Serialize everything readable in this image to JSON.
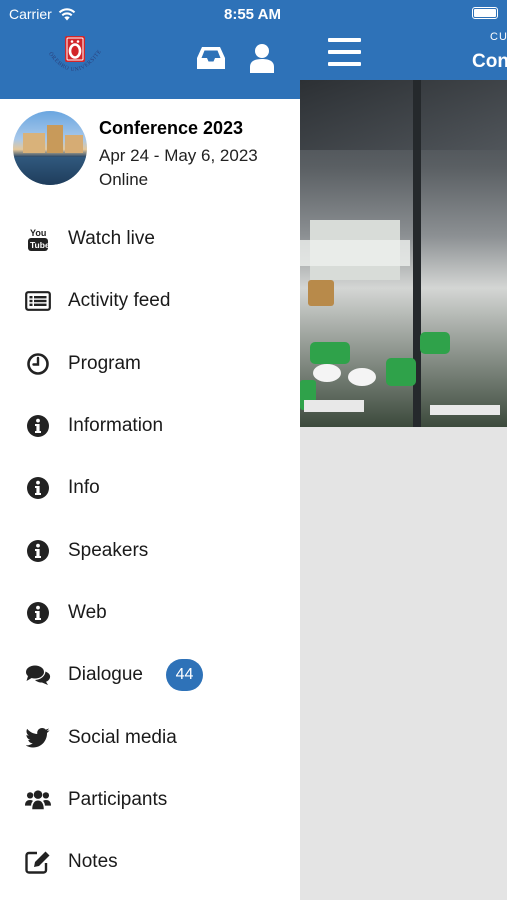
{
  "status_bar": {
    "carrier": "Carrier",
    "time": "8:55 AM"
  },
  "drawer": {
    "logo_text": "ÖREBRO UNIVERSITET",
    "event": {
      "title": "Conference 2023",
      "dates": "Apr 24 - May 6, 2023",
      "mode": "Online"
    },
    "menu": [
      {
        "label": "Watch live",
        "icon": "youtube-icon"
      },
      {
        "label": "Activity feed",
        "icon": "feed-icon"
      },
      {
        "label": "Program",
        "icon": "clock-icon"
      },
      {
        "label": "Information",
        "icon": "info-icon"
      },
      {
        "label": "Info",
        "icon": "info-icon"
      },
      {
        "label": "Speakers",
        "icon": "info-icon"
      },
      {
        "label": "Web",
        "icon": "info-icon"
      },
      {
        "label": "Dialogue",
        "icon": "comments-icon",
        "badge": "44"
      },
      {
        "label": "Social media",
        "icon": "twitter-icon"
      },
      {
        "label": "Participants",
        "icon": "users-icon"
      },
      {
        "label": "Notes",
        "icon": "edit-icon"
      }
    ]
  },
  "main": {
    "header_subtitle": "CU",
    "header_title": "Con"
  },
  "colors": {
    "brand": "#2e72b8",
    "badge": "#2e72b8",
    "logo_red": "#d2262a"
  }
}
